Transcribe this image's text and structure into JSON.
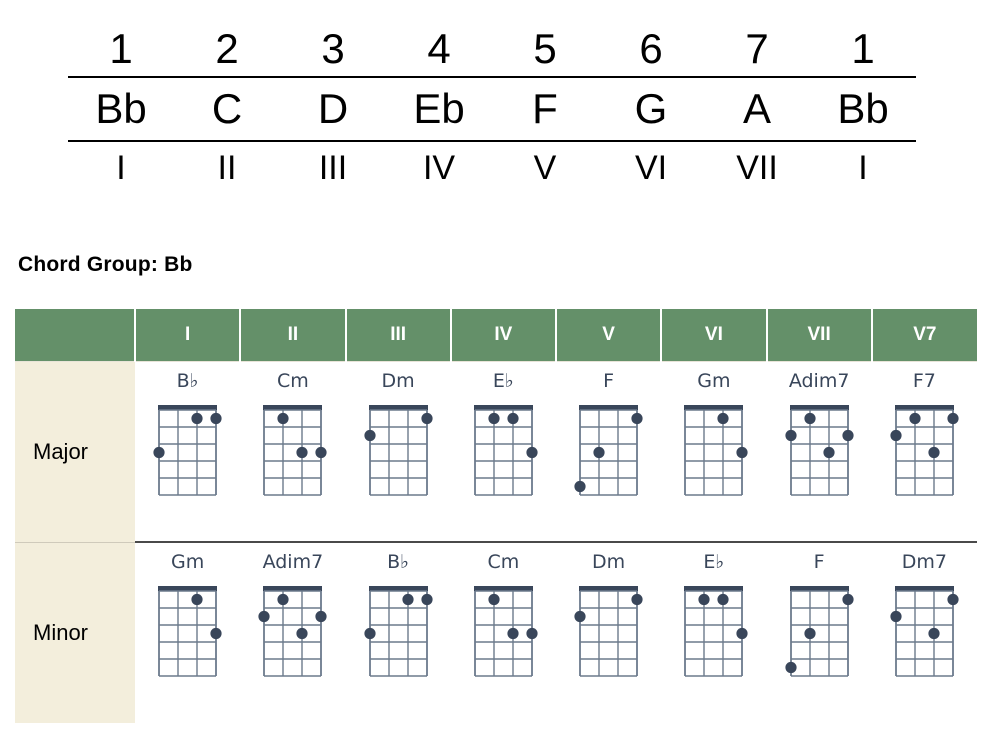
{
  "colors": {
    "header_green": "#649069",
    "row_label_cream": "#f3eedc",
    "diagram_ink": "#39465a",
    "rule_black": "#000000",
    "divider_gray": "#4a4a4a"
  },
  "scale_table": {
    "degrees": [
      "1",
      "2",
      "3",
      "4",
      "5",
      "6",
      "7",
      "1"
    ],
    "notes": [
      "Bb",
      "C",
      "D",
      "Eb",
      "F",
      "G",
      "A",
      "Bb"
    ],
    "roman": [
      "I",
      "II",
      "III",
      "IV",
      "V",
      "VI",
      "VII",
      "I"
    ]
  },
  "chord_group": {
    "title": "Chord Group:  Bb"
  },
  "chord_table": {
    "corner_label": "",
    "columns": [
      "I",
      "II",
      "III",
      "IV",
      "V",
      "VI",
      "VII",
      "V7"
    ],
    "rows": [
      {
        "label": "Major",
        "chords": [
          {
            "name": "B♭",
            "strings": 4,
            "frets": 5,
            "dots": [
              [
                3,
                1
              ],
              [
                4,
                1
              ],
              [
                1,
                3
              ]
            ]
          },
          {
            "name": "Cm",
            "strings": 4,
            "frets": 5,
            "dots": [
              [
                2,
                1
              ],
              [
                3,
                3
              ],
              [
                4,
                3
              ]
            ]
          },
          {
            "name": "Dm",
            "strings": 4,
            "frets": 5,
            "dots": [
              [
                4,
                1
              ],
              [
                1,
                2
              ]
            ]
          },
          {
            "name": "E♭",
            "strings": 4,
            "frets": 5,
            "dots": [
              [
                2,
                1
              ],
              [
                3,
                1
              ],
              [
                4,
                3
              ]
            ]
          },
          {
            "name": "F",
            "strings": 4,
            "frets": 5,
            "dots": [
              [
                4,
                1
              ],
              [
                2,
                3
              ],
              [
                1,
                5
              ]
            ]
          },
          {
            "name": "Gm",
            "strings": 4,
            "frets": 5,
            "dots": [
              [
                3,
                1
              ],
              [
                4,
                3
              ]
            ]
          },
          {
            "name": "Adim7",
            "strings": 4,
            "frets": 5,
            "dots": [
              [
                2,
                1
              ],
              [
                1,
                2
              ],
              [
                4,
                2
              ],
              [
                3,
                3
              ]
            ]
          },
          {
            "name": "F7",
            "strings": 4,
            "frets": 5,
            "dots": [
              [
                2,
                1
              ],
              [
                4,
                1
              ],
              [
                1,
                2
              ],
              [
                3,
                3
              ]
            ]
          }
        ]
      },
      {
        "label": "Minor",
        "chords": [
          {
            "name": "Gm",
            "strings": 4,
            "frets": 5,
            "dots": [
              [
                3,
                1
              ],
              [
                4,
                3
              ]
            ]
          },
          {
            "name": "Adim7",
            "strings": 4,
            "frets": 5,
            "dots": [
              [
                2,
                1
              ],
              [
                1,
                2
              ],
              [
                4,
                2
              ],
              [
                3,
                3
              ]
            ]
          },
          {
            "name": "B♭",
            "strings": 4,
            "frets": 5,
            "dots": [
              [
                3,
                1
              ],
              [
                4,
                1
              ],
              [
                1,
                3
              ]
            ]
          },
          {
            "name": "Cm",
            "strings": 4,
            "frets": 5,
            "dots": [
              [
                2,
                1
              ],
              [
                3,
                3
              ],
              [
                4,
                3
              ]
            ]
          },
          {
            "name": "Dm",
            "strings": 4,
            "frets": 5,
            "dots": [
              [
                4,
                1
              ],
              [
                1,
                2
              ]
            ]
          },
          {
            "name": "E♭",
            "strings": 4,
            "frets": 5,
            "dots": [
              [
                2,
                1
              ],
              [
                3,
                1
              ],
              [
                4,
                3
              ]
            ]
          },
          {
            "name": "F",
            "strings": 4,
            "frets": 5,
            "dots": [
              [
                4,
                1
              ],
              [
                2,
                3
              ],
              [
                1,
                5
              ]
            ]
          },
          {
            "name": "Dm7",
            "strings": 4,
            "frets": 5,
            "dots": [
              [
                4,
                1
              ],
              [
                1,
                2
              ],
              [
                3,
                3
              ]
            ]
          }
        ]
      }
    ]
  }
}
